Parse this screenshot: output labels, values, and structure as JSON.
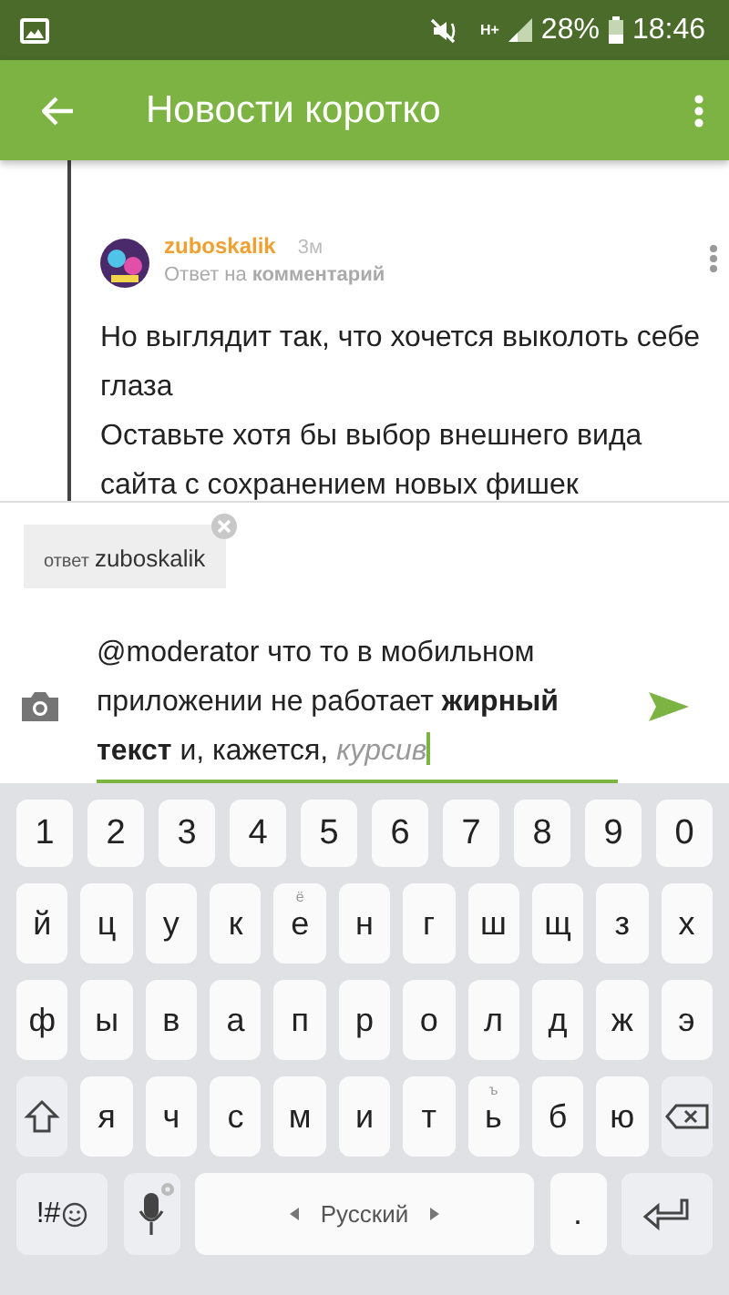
{
  "status_bar": {
    "battery": "28%",
    "network": "H+",
    "time": "18:46"
  },
  "app_bar": {
    "title": "Новости коротко"
  },
  "comment": {
    "author": "zuboskalik",
    "time": "3м",
    "reply_to": "Ответ на **комментарий**",
    "paragraphs": [
      "Но выглядит так, что хочется выколоть себе глаза",
      "Оставьте хотя бы выбор внешнего вида сайта с сохранением новых фишек"
    ]
  },
  "reply_chip": {
    "prefix": "ответ",
    "name": "zuboskalik"
  },
  "composer": {
    "value": "@moderator что то в мобильном приложении не работает **жирный текст** и, кажется, *курсив*"
  },
  "keyboard": {
    "number_keys": [
      "1",
      "2",
      "3",
      "4",
      "5",
      "6",
      "7",
      "8",
      "9",
      "0"
    ],
    "rows": [
      [
        {
          "label": "й"
        },
        {
          "label": "ц"
        },
        {
          "label": "у"
        },
        {
          "label": "к"
        },
        {
          "label": "е",
          "hint": "ё"
        },
        {
          "label": "н"
        },
        {
          "label": "г"
        },
        {
          "label": "ш"
        },
        {
          "label": "щ"
        },
        {
          "label": "з"
        },
        {
          "label": "х"
        }
      ],
      [
        {
          "label": "ф"
        },
        {
          "label": "ы"
        },
        {
          "label": "в"
        },
        {
          "label": "а"
        },
        {
          "label": "п"
        },
        {
          "label": "р"
        },
        {
          "label": "о"
        },
        {
          "label": "л"
        },
        {
          "label": "д"
        },
        {
          "label": "ж"
        },
        {
          "label": "э"
        }
      ],
      [
        {
          "kind": "shift"
        },
        {
          "label": "я"
        },
        {
          "label": "ч"
        },
        {
          "label": "с"
        },
        {
          "label": "м"
        },
        {
          "label": "и"
        },
        {
          "label": "т"
        },
        {
          "label": "ь",
          "hint": "ъ"
        },
        {
          "label": "б"
        },
        {
          "label": "ю"
        },
        {
          "kind": "backspace"
        }
      ]
    ],
    "symbols_key": "!#",
    "space_label": "Русский",
    "period_key": "."
  }
}
